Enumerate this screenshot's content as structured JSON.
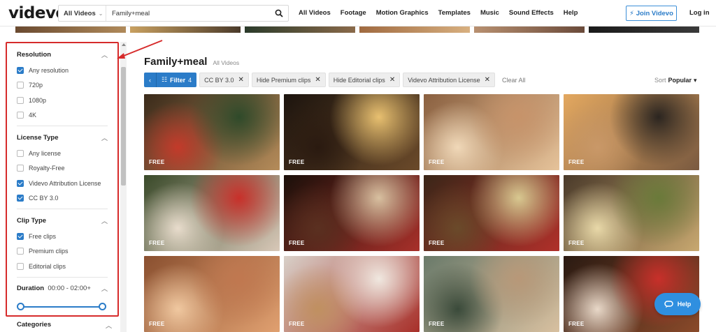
{
  "header": {
    "logo": "videvo",
    "search_category": "All Videos",
    "search_query": "Family+meal",
    "nav": [
      "All Videos",
      "Footage",
      "Motion Graphics",
      "Templates",
      "Music",
      "Sound Effects",
      "Help"
    ],
    "join_label": "Join Videvo",
    "login_label": "Log in"
  },
  "sidebar": {
    "resolution": {
      "title": "Resolution",
      "options": [
        {
          "label": "Any resolution",
          "checked": true
        },
        {
          "label": "720p",
          "checked": false
        },
        {
          "label": "1080p",
          "checked": false
        },
        {
          "label": "4K",
          "checked": false
        }
      ]
    },
    "license": {
      "title": "License Type",
      "options": [
        {
          "label": "Any license",
          "checked": false
        },
        {
          "label": "Royalty-Free",
          "checked": false
        },
        {
          "label": "Videvo Attribution License",
          "checked": true
        },
        {
          "label": "CC BY 3.0",
          "checked": true
        }
      ]
    },
    "clip_type": {
      "title": "Clip Type",
      "options": [
        {
          "label": "Free clips",
          "checked": true
        },
        {
          "label": "Premium clips",
          "checked": false
        },
        {
          "label": "Editorial clips",
          "checked": false
        }
      ]
    },
    "duration": {
      "title": "Duration",
      "range": "00:00 - 02:00+",
      "min_fraction": 0,
      "max_fraction": 1
    },
    "categories_title": "Categories"
  },
  "main": {
    "title": "Family+meal",
    "subtitle": "All Videos",
    "filter_label": "Filter",
    "filter_count": "4",
    "chips": [
      "CC BY 3.0",
      "Hide Premium clips",
      "Hide Editorial clips",
      "Videvo Attribution License"
    ],
    "clear_all": "Clear All",
    "sort_label": "Sort",
    "sort_value": "Popular",
    "badge": "FREE",
    "thumbnails": [
      {
        "scene": "hand-ornament-tree",
        "colors": [
          "#3a2a1a",
          "#b58c5a",
          "#2f4a2a",
          "#c33a2a"
        ]
      },
      {
        "scene": "champagne-toast",
        "colors": [
          "#1c140e",
          "#6b4a2a",
          "#e8c070",
          "#2a1a10"
        ]
      },
      {
        "scene": "holding-hands-bokeh",
        "colors": [
          "#8a6040",
          "#e6c39a",
          "#c7936a",
          "#f0d8b8"
        ]
      },
      {
        "scene": "couple-sunset-beach",
        "colors": [
          "#e3a860",
          "#7a5a40",
          "#2b2520",
          "#c99868"
        ]
      },
      {
        "scene": "gift-ribbon",
        "colors": [
          "#3a4a2a",
          "#d8c8b8",
          "#c8302a",
          "#e8dccc"
        ]
      },
      {
        "scene": "socks-fireplace",
        "colors": [
          "#1a100a",
          "#a8302a",
          "#d8c0a0",
          "#5a3020"
        ]
      },
      {
        "scene": "holiday-table",
        "colors": [
          "#3a2618",
          "#b0302a",
          "#d8c890",
          "#6a4a2a"
        ]
      },
      {
        "scene": "wine-glasses-table",
        "colors": [
          "#4a3a2a",
          "#c8a870",
          "#6a7a3a",
          "#e8d8a8"
        ]
      },
      {
        "scene": "hands-bokeh-warm",
        "colors": [
          "#8a5030",
          "#e0a070",
          "#c07850",
          "#f0c8a0"
        ]
      },
      {
        "scene": "christmas-sweater",
        "colors": [
          "#d8d0c8",
          "#a8302a",
          "#f0e8e0",
          "#c09060"
        ]
      },
      {
        "scene": "grandma-selfie",
        "colors": [
          "#6a7a6a",
          "#d8c0a0",
          "#b89878",
          "#3a4a3a"
        ]
      },
      {
        "scene": "feet-fireplace",
        "colors": [
          "#2a1a12",
          "#8a4a2a",
          "#c8302a",
          "#e8d8c8"
        ]
      }
    ]
  },
  "help_label": "Help",
  "colors": {
    "accent": "#2b7cc8",
    "highlight_box": "#d62b2b",
    "brand_red": "#d72f33"
  }
}
